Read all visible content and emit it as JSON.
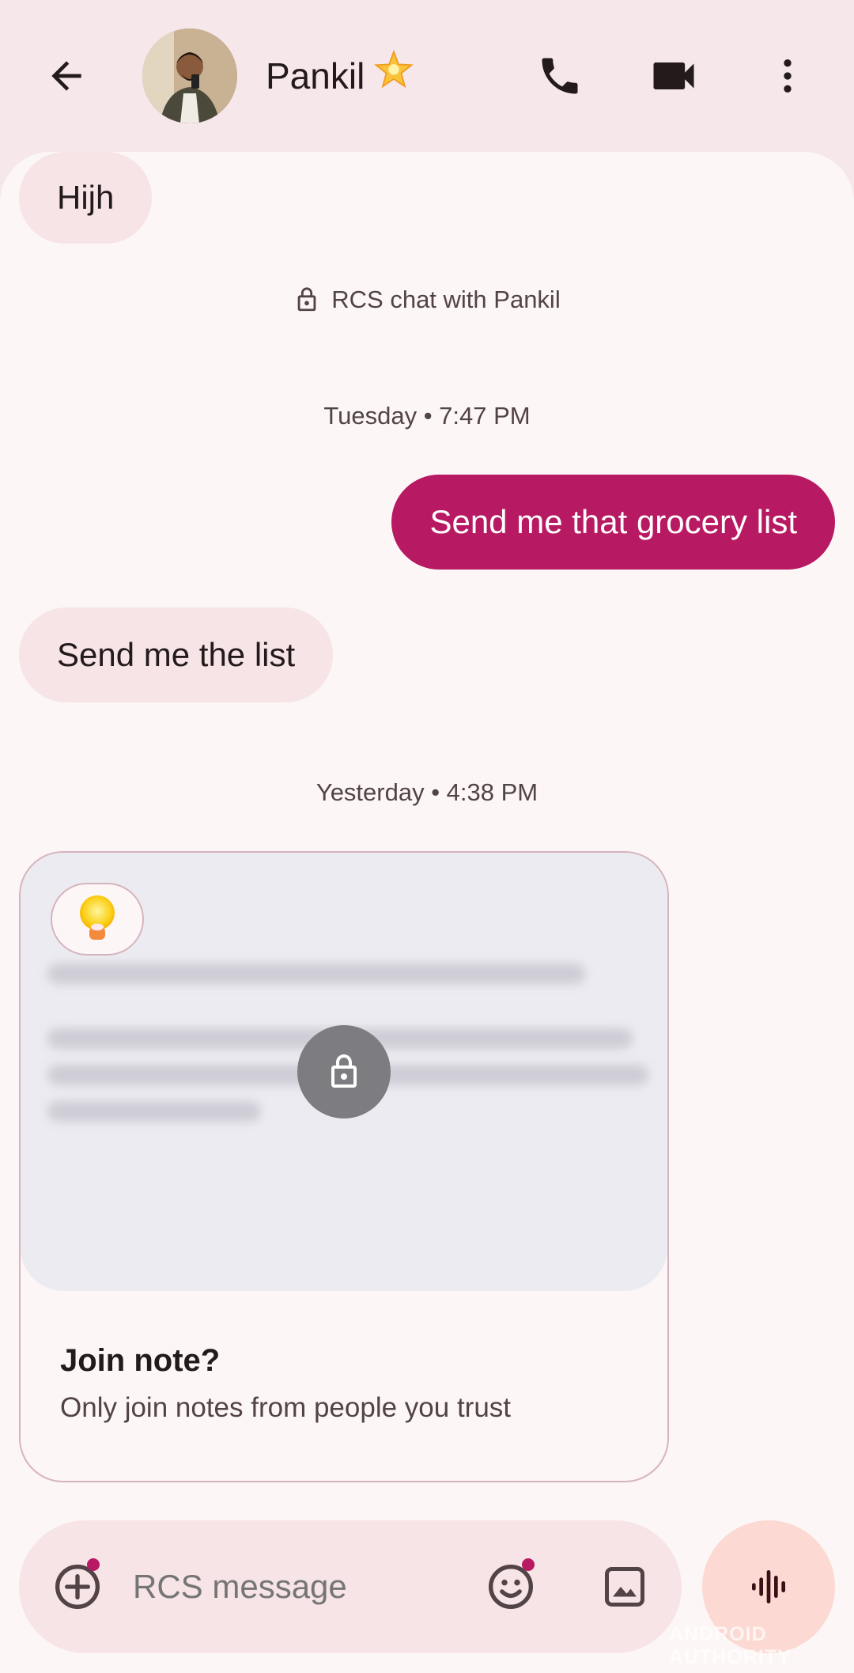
{
  "header": {
    "contact_name": "Pankil",
    "contact_emoji": "🌟",
    "icons": [
      "back-arrow-icon",
      "call-icon",
      "video-call-icon",
      "more-vert-icon"
    ]
  },
  "messages": {
    "incoming_1": "Hijh",
    "rcs_notice": "RCS chat with Pankil",
    "timestamp_1": "Tuesday • 7:47 PM",
    "outgoing_1": "Send me that grocery list",
    "incoming_2": "Send me the list",
    "timestamp_2": "Yesterday • 4:38 PM"
  },
  "note_card": {
    "title": "Join note?",
    "subtitle": "Only join notes from people you trust"
  },
  "compose": {
    "placeholder": "RCS message"
  },
  "watermark": "ANDROID AUTHORITY",
  "colors": {
    "accent": "#b71a62",
    "header_bg": "#f6e7ea",
    "chat_bg": "#fdf6f6",
    "incoming_bubble": "#f7e4e7",
    "voice_button": "#fcd9d2"
  }
}
